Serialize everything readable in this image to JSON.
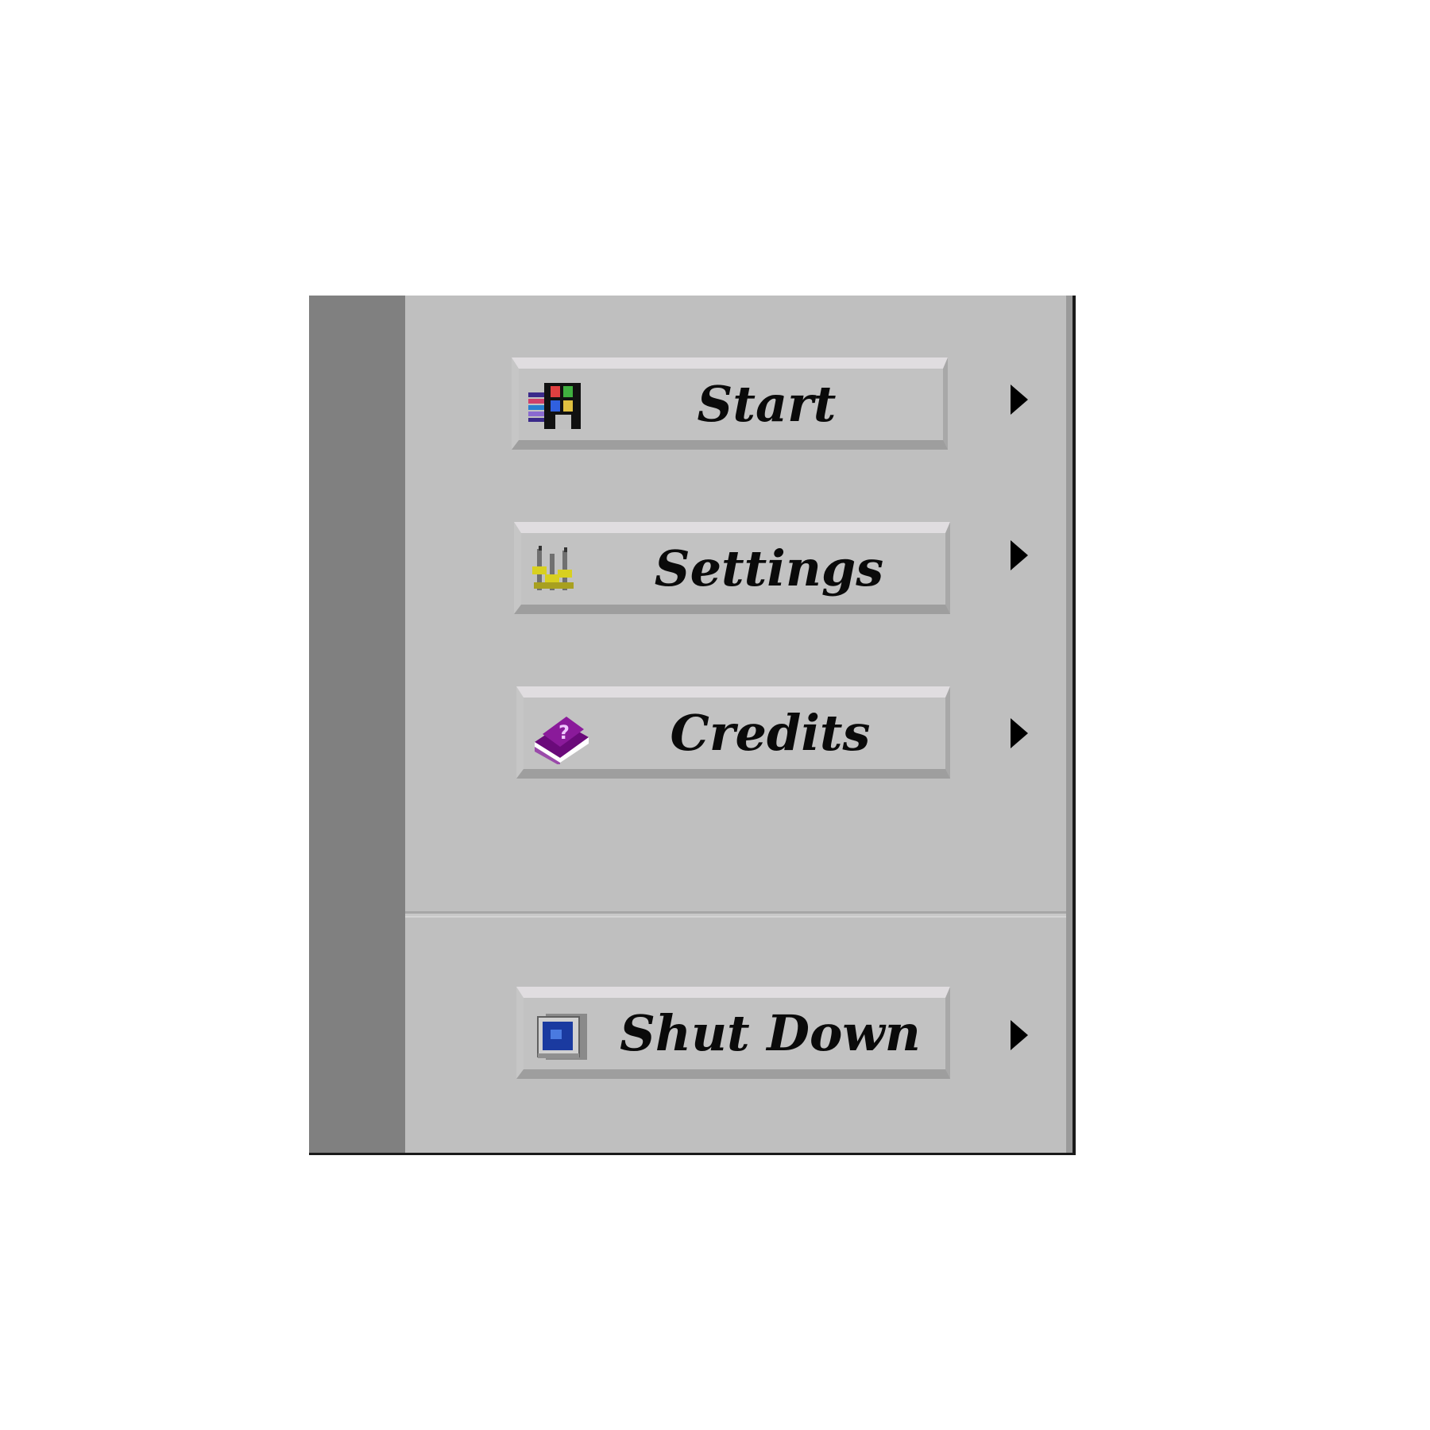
{
  "menu": {
    "items": [
      {
        "label": "Start",
        "icon": "programs-icon"
      },
      {
        "label": "Settings",
        "icon": "settings-icon"
      },
      {
        "label": "Credits",
        "icon": "help-book-icon"
      }
    ],
    "shutdown": {
      "label": "Shut Down",
      "icon": "shutdown-computer-icon"
    }
  },
  "colors": {
    "panel": "#bfbfbf",
    "side_strip": "#808080",
    "item_face": "#c2c2c2",
    "arrow": "#000000"
  }
}
